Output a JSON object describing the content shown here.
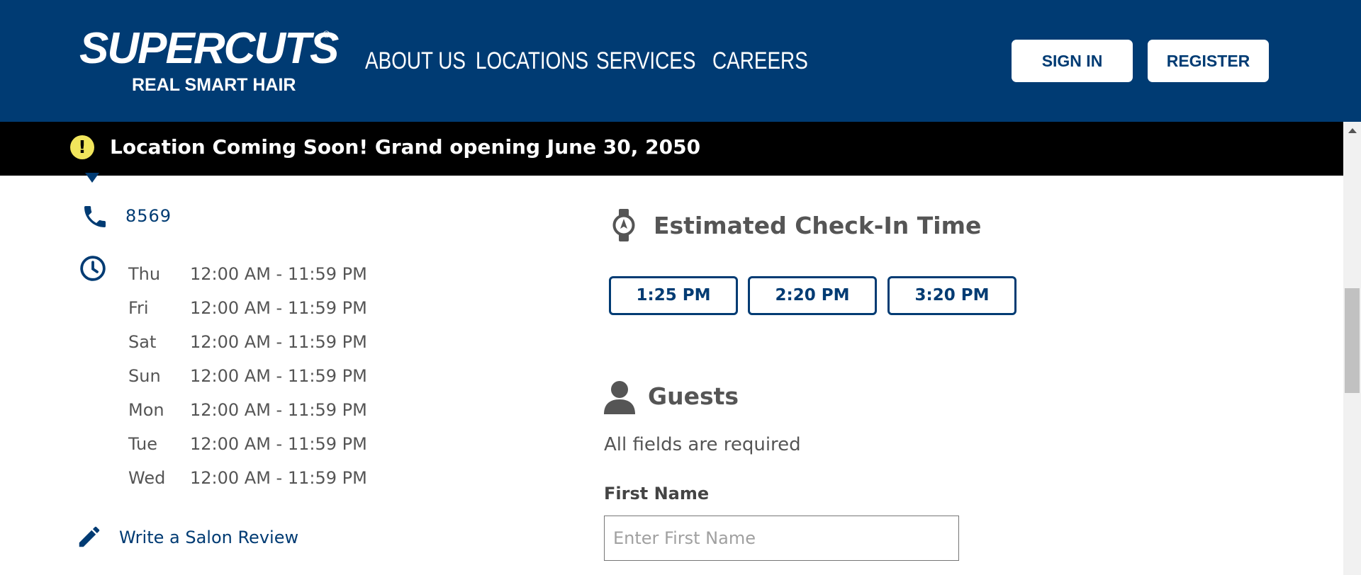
{
  "brand": {
    "name": "SUPERCUTS",
    "registered": "®",
    "tagline": "REAL SMART HAIR",
    "primary_color": "#003b73",
    "accent_yellow": "#f1e55c"
  },
  "nav": [
    {
      "label": "ABOUT US"
    },
    {
      "label": "LOCATIONS"
    },
    {
      "label": "SERVICES"
    },
    {
      "label": "CAREERS"
    }
  ],
  "auth": {
    "sign_in": "SIGN IN",
    "register": "REGISTER"
  },
  "banner": {
    "icon": "!",
    "text": "Location Coming Soon! Grand opening June 30, 2050"
  },
  "salon": {
    "phone": "8569",
    "hours": [
      {
        "day": "Thu",
        "time": "12:00 AM - 11:59 PM"
      },
      {
        "day": "Fri",
        "time": "12:00 AM - 11:59 PM"
      },
      {
        "day": "Sat",
        "time": "12:00 AM - 11:59 PM"
      },
      {
        "day": "Sun",
        "time": "12:00 AM - 11:59 PM"
      },
      {
        "day": "Mon",
        "time": "12:00 AM - 11:59 PM"
      },
      {
        "day": "Tue",
        "time": "12:00 AM - 11:59 PM"
      },
      {
        "day": "Wed",
        "time": "12:00 AM - 11:59 PM"
      }
    ],
    "review_link": "Write a Salon Review"
  },
  "checkin": {
    "title": "Estimated Check-In Time",
    "times": [
      "1:25 PM",
      "2:20 PM",
      "3:20 PM"
    ]
  },
  "guests": {
    "title": "Guests",
    "required_note": "All fields are required",
    "first_name_label": "First Name",
    "first_name_placeholder": "Enter First Name",
    "first_name_value": ""
  }
}
